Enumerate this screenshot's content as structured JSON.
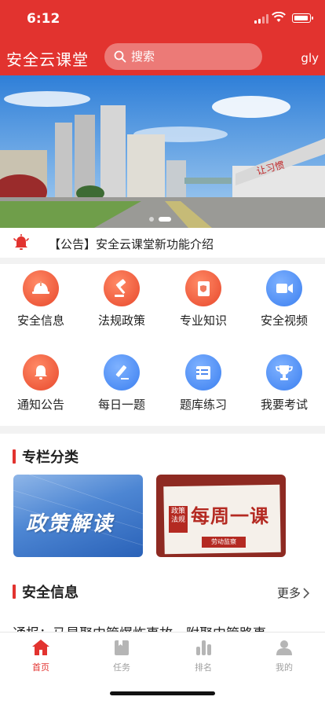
{
  "status": {
    "time": "6:12"
  },
  "header": {
    "title": "安全云课堂",
    "search_placeholder": "搜索",
    "user": "gly"
  },
  "notice": {
    "text": "【公告】安全云课堂新功能介绍"
  },
  "grid": {
    "items": [
      {
        "label": "安全信息",
        "icon": "helmet-icon",
        "color": "red"
      },
      {
        "label": "法规政策",
        "icon": "gavel-icon",
        "color": "red"
      },
      {
        "label": "专业知识",
        "icon": "book-icon",
        "color": "red"
      },
      {
        "label": "安全视频",
        "icon": "video-icon",
        "color": "blue"
      },
      {
        "label": "通知公告",
        "icon": "bell-icon",
        "color": "red"
      },
      {
        "label": "每日一题",
        "icon": "pencil-icon",
        "color": "blue"
      },
      {
        "label": "题库练习",
        "icon": "question-bank-icon",
        "color": "blue"
      },
      {
        "label": "我要考试",
        "icon": "trophy-icon",
        "color": "blue"
      }
    ]
  },
  "columns": {
    "title": "专栏分类",
    "card1": {
      "title": "政策解读"
    },
    "card2": {
      "tag": "政策法规",
      "title": "每周一课",
      "subtitle": "劳动监察"
    }
  },
  "safety": {
    "title": "安全信息",
    "more": "更多",
    "preview": "通报：马星聚中管爆炸事故，附聚中管路事"
  },
  "tabbar": {
    "tabs": [
      {
        "label": "首页",
        "icon": "home-icon",
        "active": true
      },
      {
        "label": "任务",
        "icon": "task-icon",
        "active": false
      },
      {
        "label": "排名",
        "icon": "ranking-icon",
        "active": false
      },
      {
        "label": "我的",
        "icon": "profile-icon",
        "active": false
      }
    ]
  },
  "colors": {
    "brand_red": "#e2332f",
    "inactive_gray": "#a0a0a0"
  }
}
